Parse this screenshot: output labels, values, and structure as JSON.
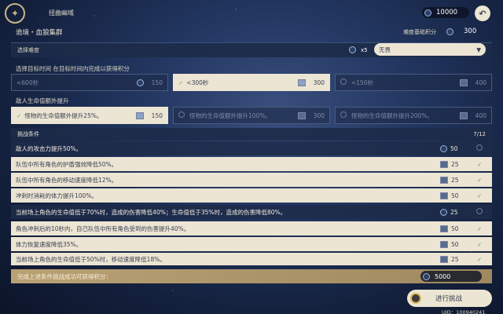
{
  "header": {
    "title": "扭曲幽域",
    "currency": "10000"
  },
  "domain": {
    "name": "诡境・血狼集群",
    "base_label": "难度基础积分",
    "base_value": "300"
  },
  "difficulty": {
    "label": "选择难度",
    "multiplier": "x5",
    "selected": "无畏"
  },
  "time": {
    "label": "选择目标时间 在目标时间内完成以获得积分",
    "options": [
      {
        "label": "<600秒",
        "points": "150"
      },
      {
        "label": "<300秒",
        "points": "300"
      },
      {
        "label": "<150秒",
        "points": "400"
      }
    ]
  },
  "hp": {
    "label": "敌人生命值额外提升",
    "options": [
      {
        "label": "怪物的生命值额外提升25%。",
        "points": "150"
      },
      {
        "label": "怪物的生命值额外提升100%。",
        "points": "300"
      },
      {
        "label": "怪物的生命值额外提升200%。",
        "points": "400"
      }
    ]
  },
  "conditions": {
    "label": "挑战条件",
    "count": "7/12",
    "items": [
      {
        "text": "敌人的攻击力提升50%。",
        "points": "50",
        "active": false
      },
      {
        "text": "队伍中所有角色的护盾强效降低50%。",
        "points": "25",
        "active": true
      },
      {
        "text": "队伍中所有角色的移动速度降低12%。",
        "points": "25",
        "active": true
      },
      {
        "text": "冲刺时消耗的体力提升100%。",
        "points": "50",
        "active": true
      },
      {
        "text": "当前场上角色的生命值低于70%时，造成的伤害降低40%；生命值低于35%时，造成的伤害降低80%。",
        "points": "25",
        "active": false
      },
      {
        "text": "角色冲刺后的10秒内，自己队伍中所有角色受到的伤害提升40%。",
        "points": "50",
        "active": true
      },
      {
        "text": "体力恢复速度降低35%。",
        "points": "50",
        "active": true
      },
      {
        "text": "当前场上角色的生命值低于50%时，移动速度降低18%。",
        "points": "25",
        "active": true
      }
    ]
  },
  "reward": {
    "label": "完成上述条件挑战成功可获得积分：",
    "value": "5000"
  },
  "start_button": "进行挑战",
  "uid": "UID：100940241"
}
